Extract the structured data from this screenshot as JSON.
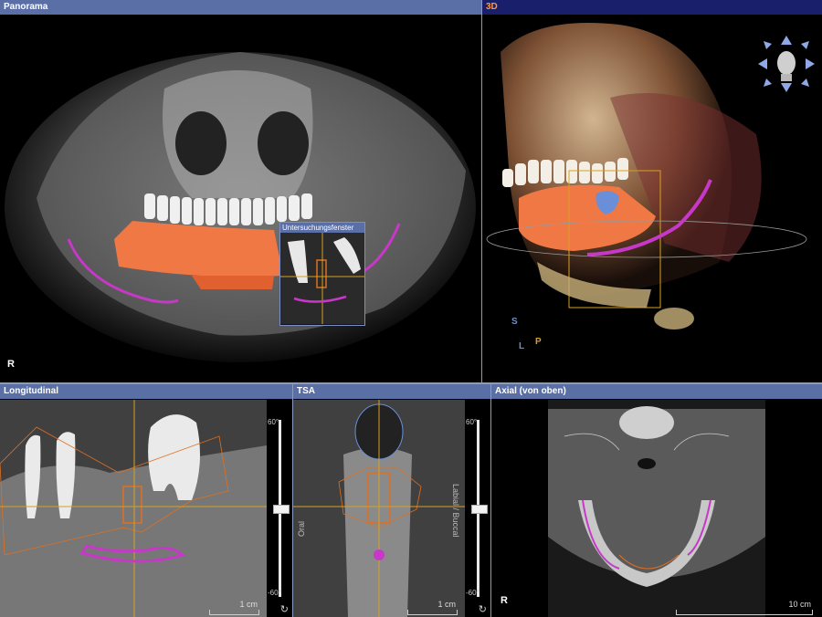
{
  "panels": {
    "panorama": {
      "title": "Panorama",
      "orientation": "R",
      "inset_title": "Untersuchungsfenster"
    },
    "view3d": {
      "title": "3D",
      "axis_s": "S",
      "axis_l": "L",
      "axis_p": "P"
    },
    "longitudinal": {
      "title": "Longitudinal",
      "angle_top": "60°",
      "angle_bottom": "-60°",
      "scale": "1 cm"
    },
    "tsa": {
      "title": "TSA",
      "left_label": "Oral",
      "right_label": "Labial / Buccal",
      "angle_top": "60°",
      "angle_bottom": "-60°",
      "scale": "1 cm"
    },
    "axial": {
      "title": "Axial (von oben)",
      "orientation": "R",
      "scale": "10 cm"
    }
  },
  "colors": {
    "title_bar": "#5a6fa6",
    "title_3d_bg": "#1a1f6b",
    "title_3d_text": "#ff9a3c",
    "nerve": "#c838c8",
    "implant": "#e07020",
    "guide": "#d8a020"
  },
  "icons": {
    "rotate": "rotate-icon",
    "head": "head-navigator-icon"
  }
}
